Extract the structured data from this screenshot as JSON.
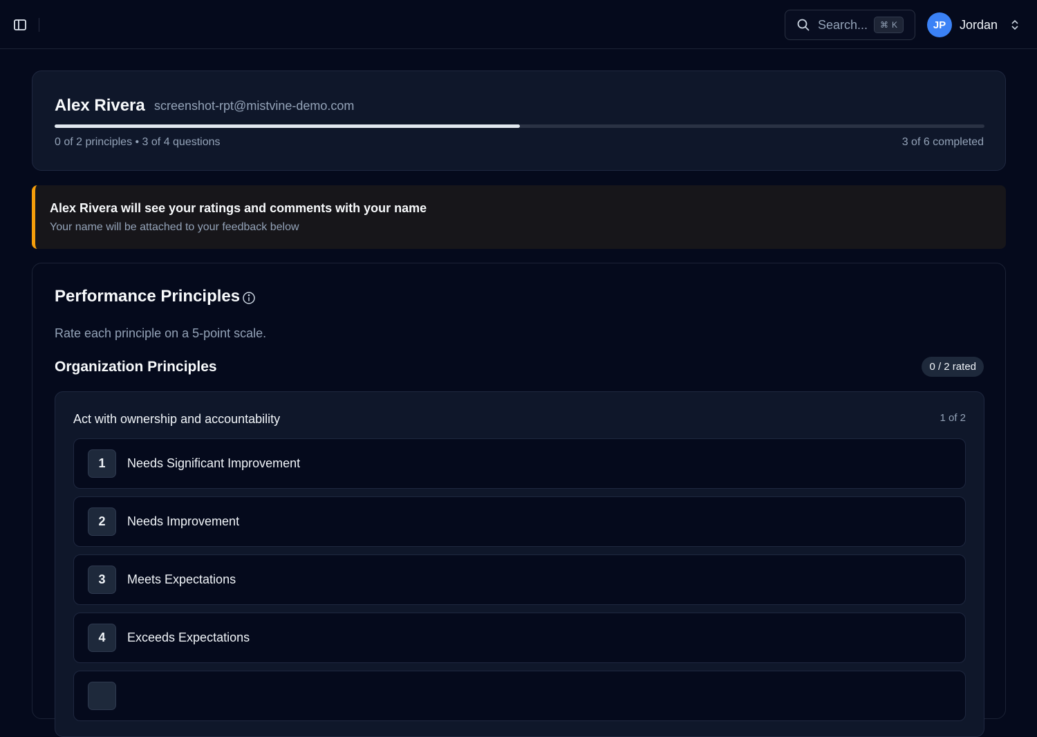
{
  "topbar": {
    "search_label": "Search...",
    "shortcut_symbol": "⌘",
    "shortcut_key": "K",
    "user_initials": "JP",
    "user_name": "Jordan"
  },
  "profile": {
    "name": "Alex Rivera",
    "email": "screenshot-rpt@mistvine-demo.com",
    "progress_fraction": 0.5,
    "summary": "0 of 2 principles • 3 of 4 questions",
    "count": "3 of 6 completed"
  },
  "notice": {
    "title": "Alex Rivera will see your ratings and comments with your name",
    "subtitle": "Your name will be attached to your feedback below",
    "accent_color": "#f59e0b"
  },
  "section": {
    "title": "Performance Principles",
    "description": "Rate each principle on a 5-point scale.",
    "group_title": "Organization Principles",
    "rated_badge": "0 / 2 rated"
  },
  "principle": {
    "title": "Act with ownership and accountability",
    "position": "1 of 2",
    "options": [
      {
        "num": "1",
        "label": "Needs Significant Improvement"
      },
      {
        "num": "2",
        "label": "Needs Improvement"
      },
      {
        "num": "3",
        "label": "Meets Expectations"
      },
      {
        "num": "4",
        "label": "Exceeds Expectations"
      },
      {
        "num": "",
        "label": ""
      }
    ]
  },
  "colors": {
    "background": "#050a1c",
    "card": "#0f172a",
    "avatar": "#3b82f6",
    "accent": "#f59e0b"
  },
  "icons": [
    "sidebar-toggle-icon",
    "search-icon",
    "chevron-up-down-icon",
    "info-icon"
  ]
}
